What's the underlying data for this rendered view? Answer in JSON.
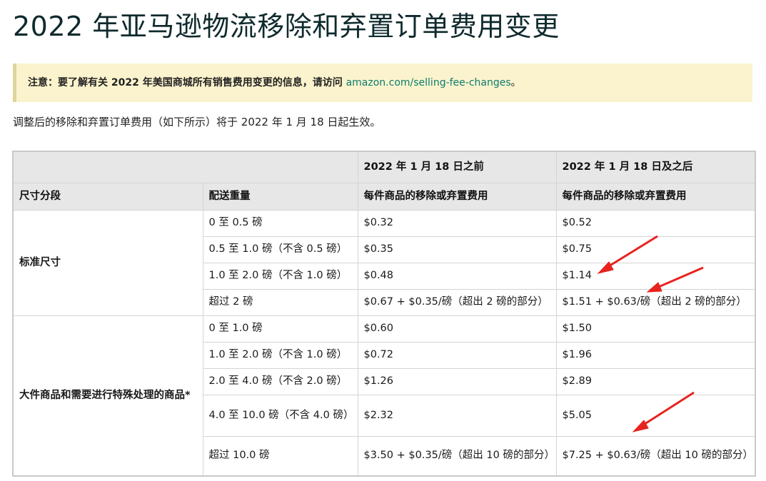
{
  "page_title": "2022 年亚马逊物流移除和弃置订单费用变更",
  "notice": {
    "label": "注意：",
    "text": "要了解有关 2022 年美国商城所有销售费用变更的信息，请访问 ",
    "link": "amazon.com/selling-fee-changes",
    "suffix": "。"
  },
  "intro": "调整后的移除和弃置订单费用（如下所示）将于 2022 年 1 月 18 日起生效。",
  "table": {
    "header_before": "2022 年 1 月 18 日之前",
    "header_after": "2022 年 1 月 18 日及之后",
    "col_size": "尺寸分段",
    "col_weight": "配送重量",
    "col_fee_before": "每件商品的移除或弃置费用",
    "col_fee_after": "每件商品的移除或弃置费用",
    "groups": [
      {
        "size": "标准尺寸",
        "rows": [
          {
            "weight": "0 至 0.5 磅",
            "before": "$0.32",
            "after": "$0.52"
          },
          {
            "weight": "0.5 至 1.0 磅（不含 0.5 磅）",
            "before": "$0.35",
            "after": "$0.75"
          },
          {
            "weight": "1.0 至 2.0 磅（不含 1.0 磅）",
            "before": "$0.48",
            "after": "$1.14"
          },
          {
            "weight": "超过 2 磅",
            "before": "$0.67 + $0.35/磅（超出 2 磅的部分）",
            "after": "$1.51 + $0.63/磅（超出 2 磅的部分）"
          }
        ]
      },
      {
        "size": "大件商品和需要进行特殊处理的商品*",
        "rows": [
          {
            "weight": "0 至 1.0 磅",
            "before": "$0.60",
            "after": "$1.50"
          },
          {
            "weight": "1.0 至 2.0 磅（不含 1.0 磅）",
            "before": "$0.72",
            "after": "$1.96"
          },
          {
            "weight": "2.0 至 4.0 磅（不含 2.0 磅）",
            "before": "$1.26",
            "after": "$2.89"
          },
          {
            "weight": "4.0 至 10.0 磅（不含 4.0 磅）",
            "before": "$2.32",
            "after": "$5.05"
          },
          {
            "weight": "超过 10.0 磅",
            "before": "$3.50 + $0.35/磅（超出 10 磅的部分）",
            "after": "$7.25 + $0.63/磅（超出 10 磅的部分）"
          }
        ]
      }
    ]
  },
  "colors": {
    "notice_bg": "#fbf3cd",
    "link": "#0a7c6e",
    "header_bg": "#e7e7e7",
    "annotation_arrow": "#e8231f"
  }
}
